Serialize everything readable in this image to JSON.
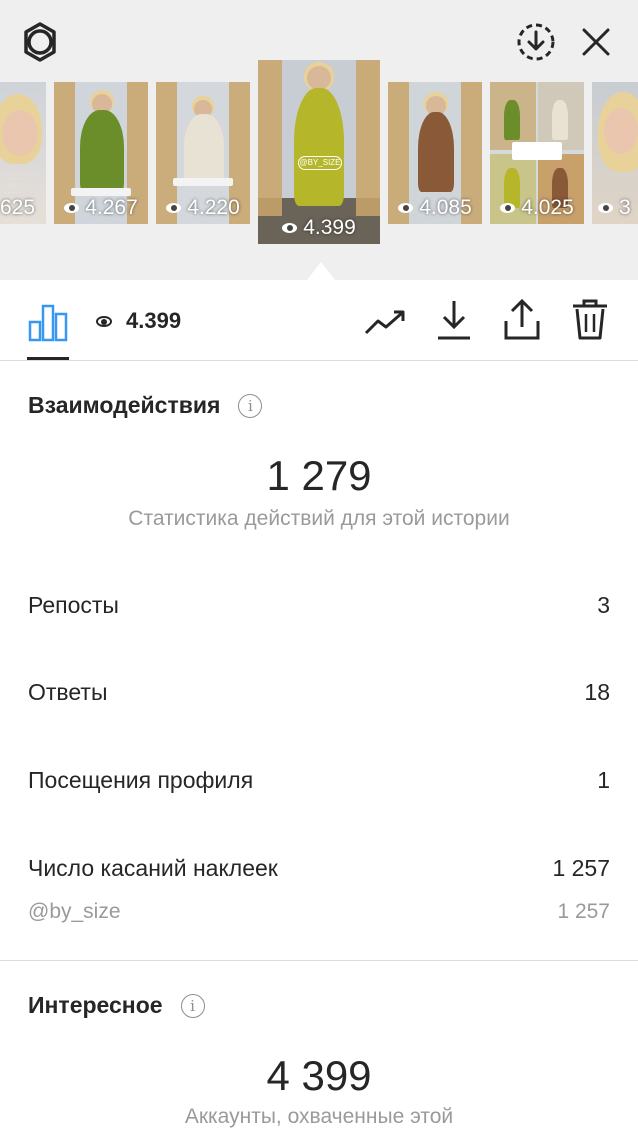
{
  "header": {
    "settings_icon": "gear-icon",
    "download_icon": "dashed-download-icon",
    "close_icon": "close-icon"
  },
  "stories": [
    {
      "views": "625"
    },
    {
      "views": "4.267"
    },
    {
      "views": "4.220"
    },
    {
      "views": "4.399",
      "sticker": "@BY_SIZE"
    },
    {
      "views": "4.085"
    },
    {
      "views": "4.025"
    },
    {
      "views": "3"
    }
  ],
  "toolbar": {
    "views": "4.399"
  },
  "interactions": {
    "title": "Взаимодействия",
    "total": "1 279",
    "caption": "Статистика действий для этой истории",
    "rows": [
      {
        "label": "Репосты",
        "value": "3"
      },
      {
        "label": "Ответы",
        "value": "18"
      },
      {
        "label": "Посещения профиля",
        "value": "1"
      },
      {
        "label": "Число касаний наклеек",
        "value": "1 257"
      }
    ],
    "sub_row": {
      "label": "@by_size",
      "value": "1 257"
    }
  },
  "discovery": {
    "title": "Интересное",
    "total": "4 399",
    "caption": "Аккаунты, охваченные этой"
  }
}
